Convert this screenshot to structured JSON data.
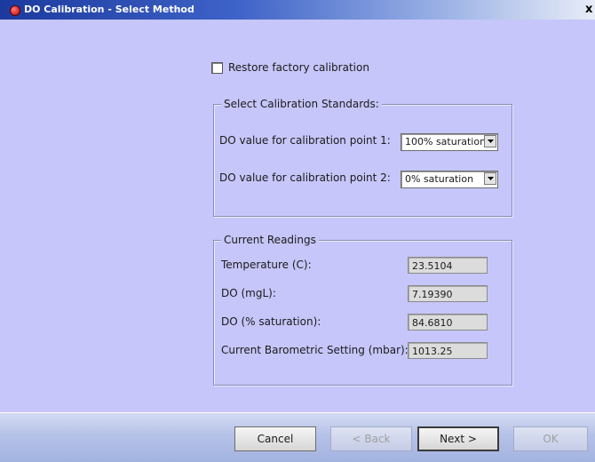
{
  "window": {
    "title": "DO Calibration - Select Method",
    "close_symbol": "x"
  },
  "restore": {
    "label": "Restore factory calibration",
    "checked": false
  },
  "standards": {
    "title": "Select Calibration Standards:",
    "point1_label": "DO value for calibration point 1:",
    "point1_value": "100% saturation",
    "point2_label": "DO value for calibration point 2:",
    "point2_value": "0% saturation"
  },
  "readings": {
    "title": "Current Readings",
    "items": [
      {
        "label": "Temperature (C):",
        "value": "23.5104"
      },
      {
        "label": "DO (mgL):",
        "value": "7.19390"
      },
      {
        "label": "DO (% saturation):",
        "value": "84.6810"
      },
      {
        "label": "Current Barometric Setting (mbar):",
        "value": "1013.25"
      }
    ]
  },
  "buttons": {
    "cancel": "Cancel",
    "back": "< Back",
    "next": "Next >",
    "ok": "OK"
  },
  "icons": {
    "app": "app-icon",
    "close": "close-icon",
    "dropdown": "chevron-down-icon",
    "checkbox": "checkbox-icon"
  },
  "colors": {
    "background": "#c6c6fa",
    "titlebar": "#1c3a9e",
    "footer": "#b5c2e8",
    "readonly_field": "#dcdcdc"
  }
}
